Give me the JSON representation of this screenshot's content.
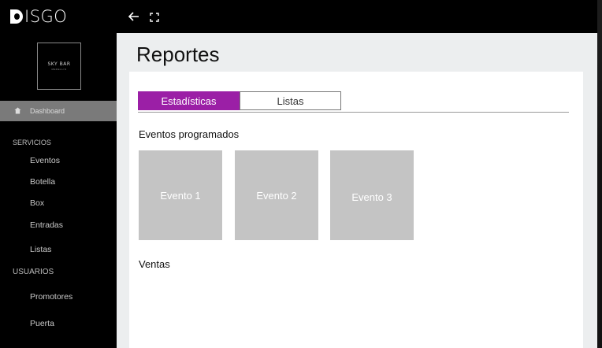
{
  "topbar": {
    "logo_text": "DISGO",
    "back_icon": "arrow-left-icon",
    "fullscreen_icon": "fullscreen-icon"
  },
  "sidebar": {
    "brand": {
      "name": "SKY BAR",
      "sub": "MEDELLIN"
    },
    "dashboard_label": "Dashboard",
    "sections": [
      {
        "title": "SERVICIOS",
        "items": [
          "Eventos",
          "Botella",
          "Box",
          "Entradas",
          "Listas"
        ]
      },
      {
        "title": "USUARIOS",
        "items": [
          "Promotores",
          "Puerta"
        ]
      }
    ]
  },
  "main": {
    "title": "Reportes",
    "tabs": [
      {
        "label": "Estadísticas",
        "active": true
      },
      {
        "label": "Listas",
        "active": false
      }
    ],
    "events_heading": "Eventos programados",
    "events": [
      "Evento 1",
      "Evento 2",
      "Evento 3"
    ],
    "sales_heading": "Ventas"
  },
  "colors": {
    "accent": "#9b1fa6",
    "sidebar_bg": "#000000",
    "tile_bg": "#c4c4c4",
    "main_bg": "#eceeef"
  }
}
